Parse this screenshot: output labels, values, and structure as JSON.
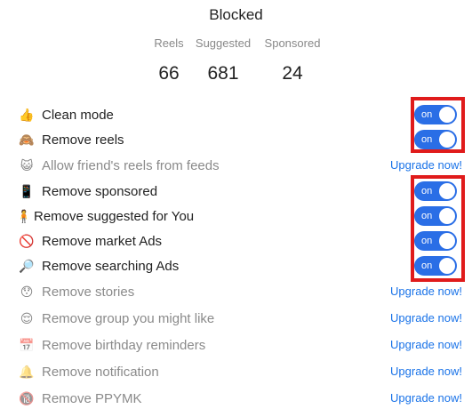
{
  "header": {
    "title": "Blocked"
  },
  "stats": {
    "labels": [
      "Reels",
      "Suggested",
      "Sponsored"
    ],
    "values": [
      "66",
      "681",
      "24"
    ]
  },
  "toggle_text": "on",
  "upgrade_text": "Upgrade now!",
  "items": [
    {
      "label": "Clean mode",
      "icon": "thumbs-up-icon",
      "state": "on"
    },
    {
      "label": "Remove reels",
      "icon": "see-no-evil-monkey-icon",
      "state": "on"
    },
    {
      "label": "Allow friend's reels from feeds",
      "icon": "cat-face-icon",
      "state": "upgrade"
    },
    {
      "label": "Remove sponsored",
      "icon": "mobile-phone-icon",
      "state": "on"
    },
    {
      "label": "Remove suggested for You",
      "icon": "person-icon",
      "state": "on"
    },
    {
      "label": "Remove market Ads",
      "icon": "prohibited-icon",
      "state": "on"
    },
    {
      "label": "Remove searching Ads",
      "icon": "magnifying-glass-icon",
      "state": "on"
    },
    {
      "label": "Remove stories",
      "icon": "face-icon",
      "state": "upgrade"
    },
    {
      "label": "Remove group you might like",
      "icon": "face-icon",
      "state": "upgrade"
    },
    {
      "label": "Remove birthday reminders",
      "icon": "calendar-icon",
      "state": "upgrade"
    },
    {
      "label": "Remove notification",
      "icon": "bell-icon",
      "state": "upgrade"
    },
    {
      "label": "Remove PPYMK",
      "icon": "no-under-eighteen-icon",
      "state": "upgrade"
    }
  ],
  "colors": {
    "toggle_on": "#2a6ee6",
    "highlight": "#e01b1b",
    "link": "#1a73e8"
  }
}
